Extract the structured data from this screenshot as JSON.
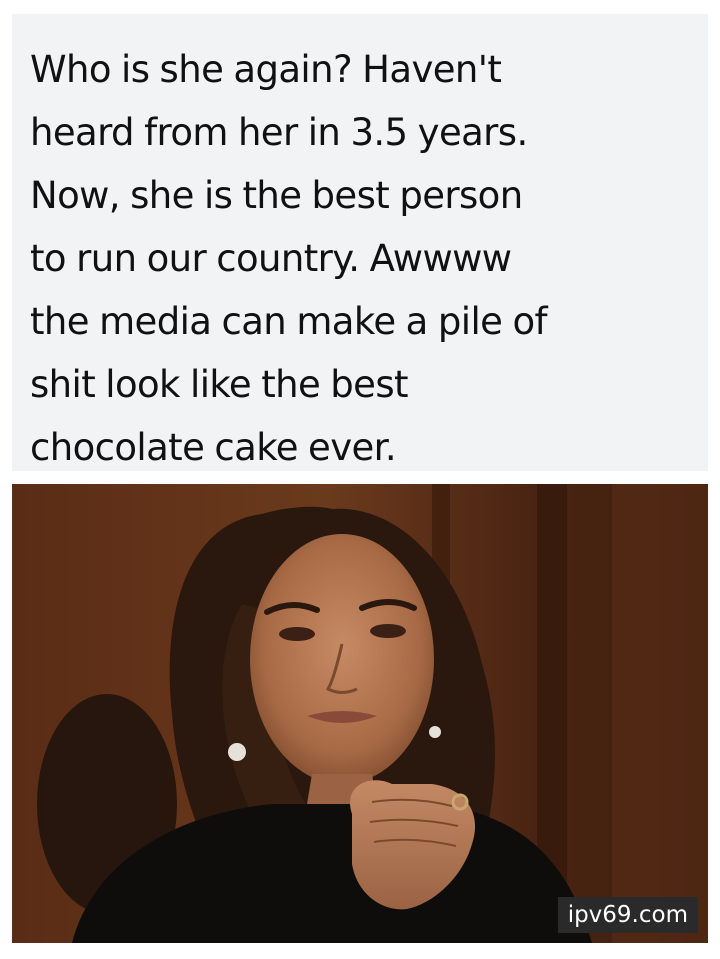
{
  "caption": {
    "lines": [
      "Who is she again? Haven't",
      "heard from her in 3.5 years.",
      "Now, she is the best person",
      "to run our country. Awwww",
      "the media can make a pile of",
      "shit look like the best",
      "chocolate cake ever."
    ]
  },
  "photo": {
    "subject": "woman-with-clasped-hands-portrait-icon"
  },
  "watermark": {
    "text": "ipv69.com"
  },
  "colors": {
    "panel_background": "#f1f3f4",
    "text": "#111111",
    "photo_background": "#4a2514",
    "watermark_background": "#2a2a2a",
    "watermark_text": "#ffffff"
  }
}
